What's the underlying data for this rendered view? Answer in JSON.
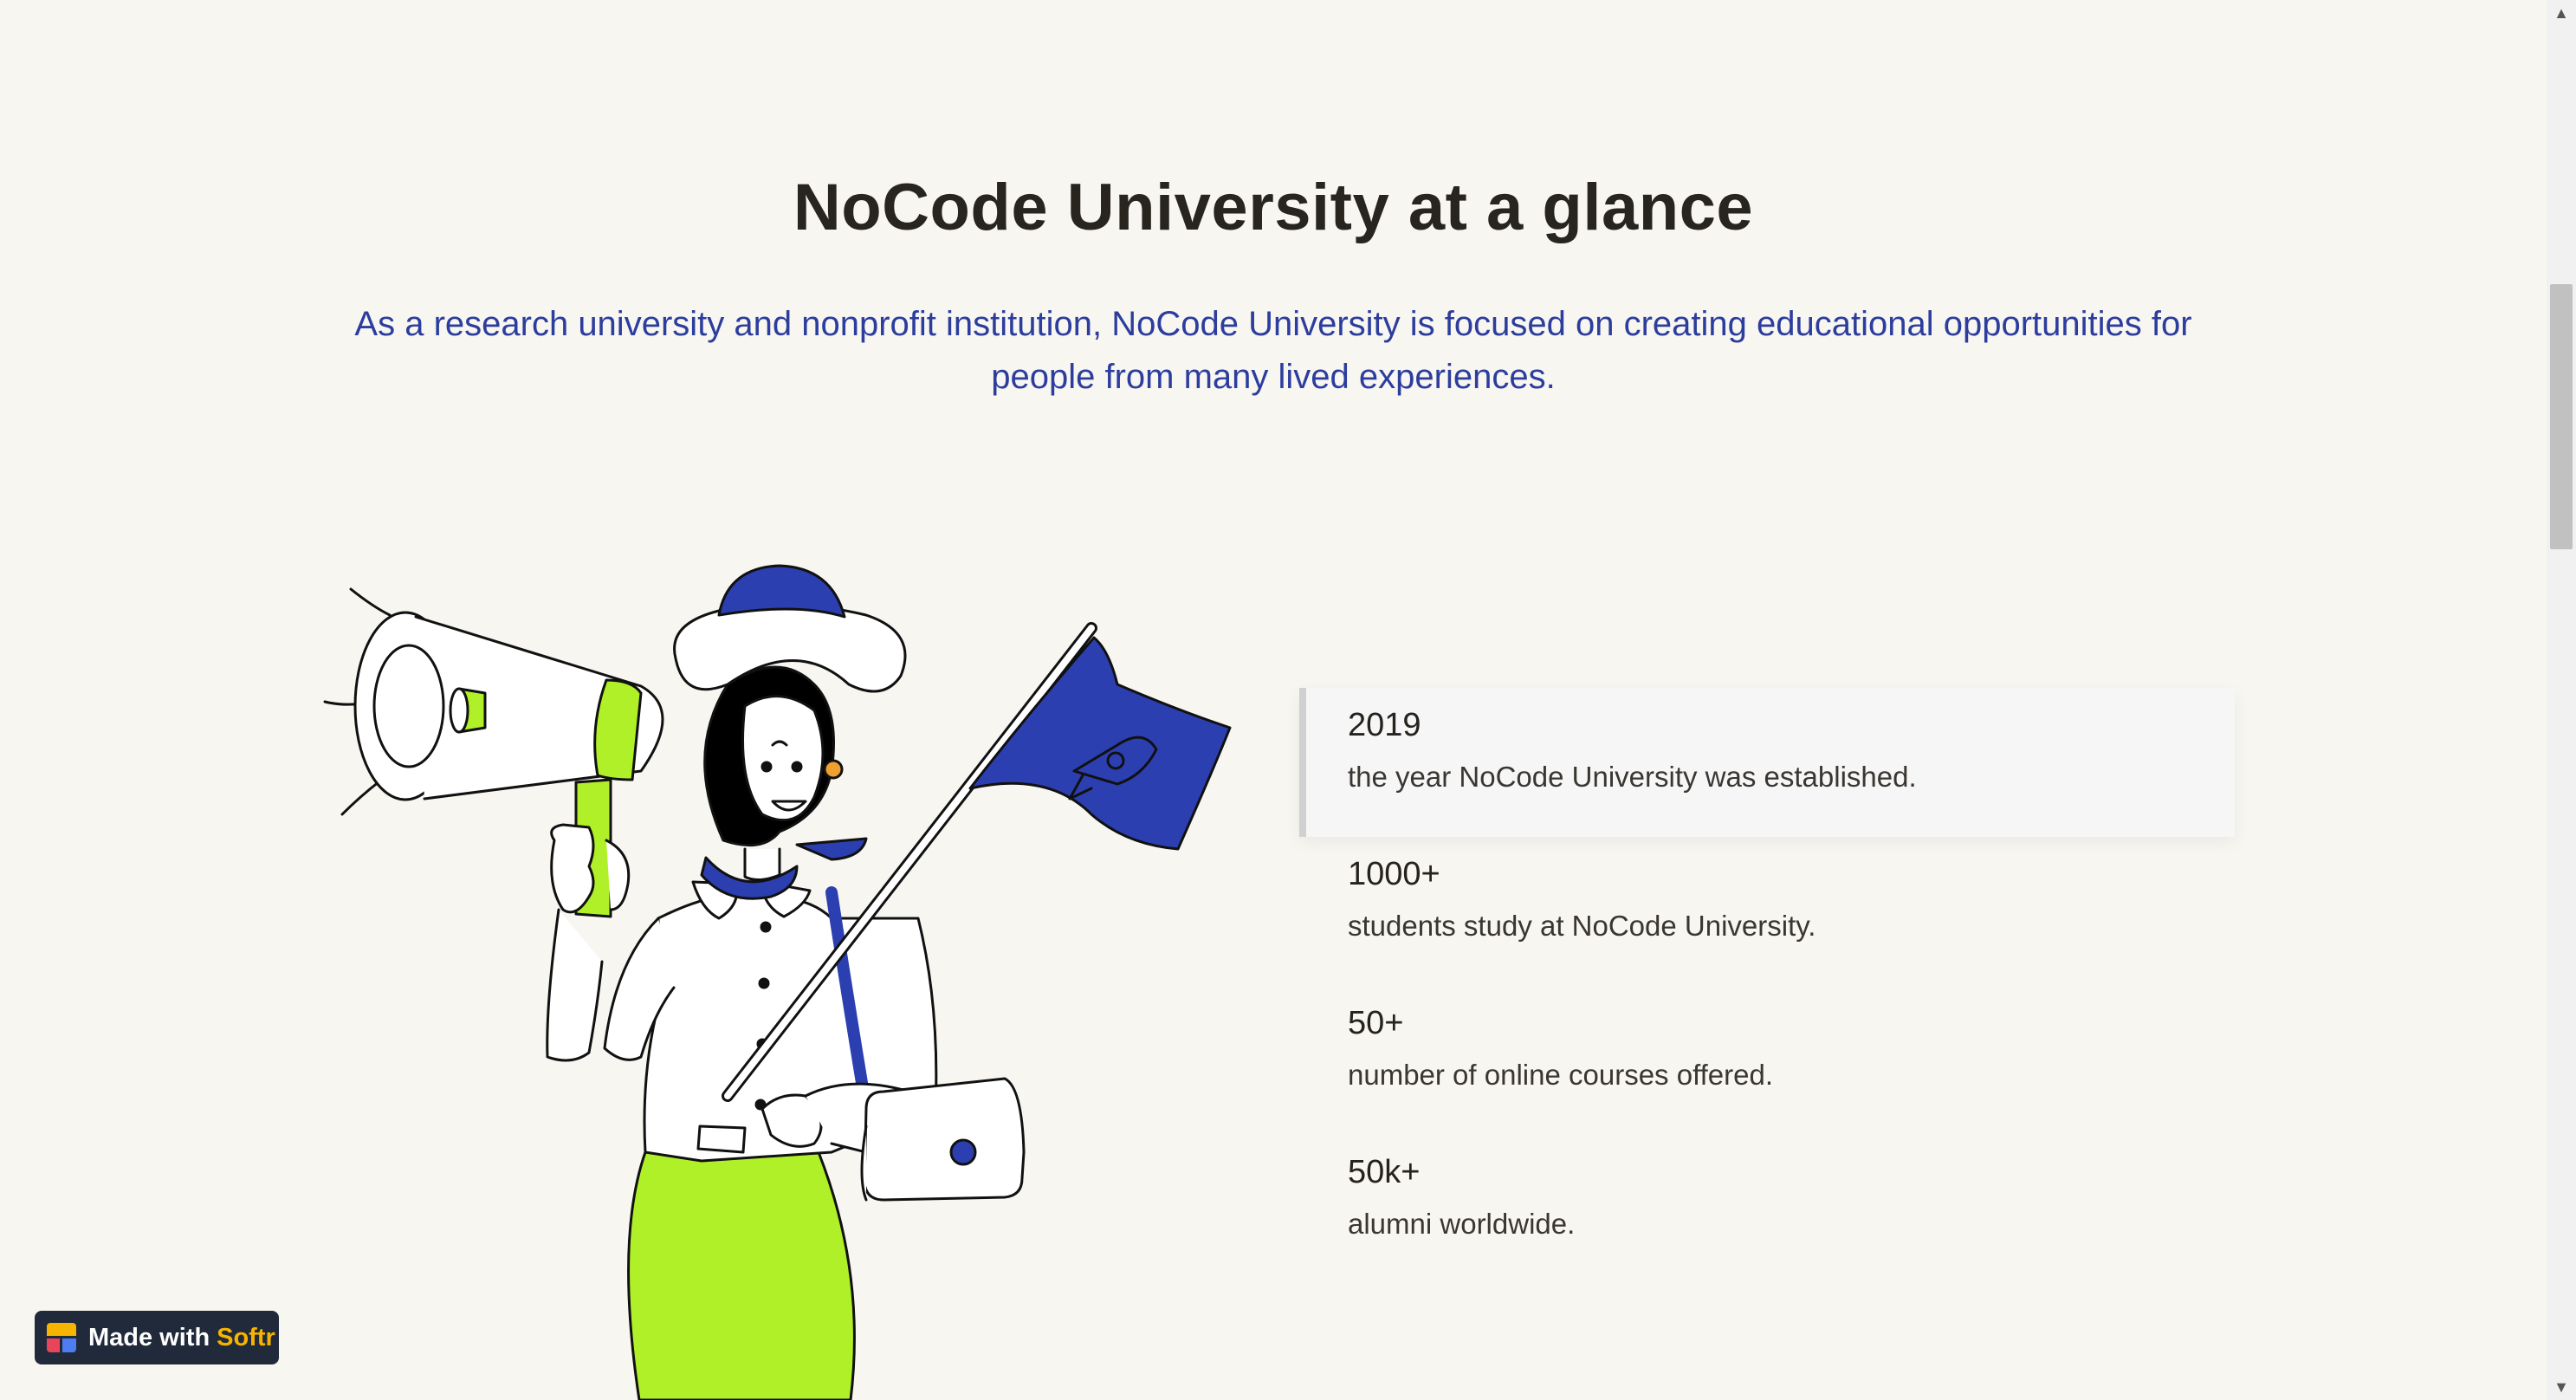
{
  "section": {
    "title": "NoCode University at a glance",
    "subtitle": "As a research university and nonprofit institution, NoCode University is focused on creating educational opportunities for people from many lived experiences."
  },
  "stats": [
    {
      "value": "2019",
      "description": "the year NoCode University was established."
    },
    {
      "value": "1000+",
      "description": "students study at NoCode University."
    },
    {
      "value": "50+",
      "description": "number of online courses offered."
    },
    {
      "value": "50k+",
      "description": "alumni worldwide."
    }
  ],
  "badge": {
    "prefix": "Made with",
    "brand": "Softr"
  },
  "colors": {
    "background": "#f8f6f1",
    "title": "#28251f",
    "subtitle": "#2c3d9e",
    "accent_green": "#b0f028",
    "accent_blue": "#2c3fb0",
    "badge_bg": "#212a3b",
    "badge_brand": "#f5b400"
  },
  "icons": {
    "illustration": "woman-with-megaphone-and-rocket-flag",
    "badge_logo": "softr-logo-icon",
    "scroll_up": "chevron-up-icon",
    "scroll_down": "chevron-down-icon"
  }
}
